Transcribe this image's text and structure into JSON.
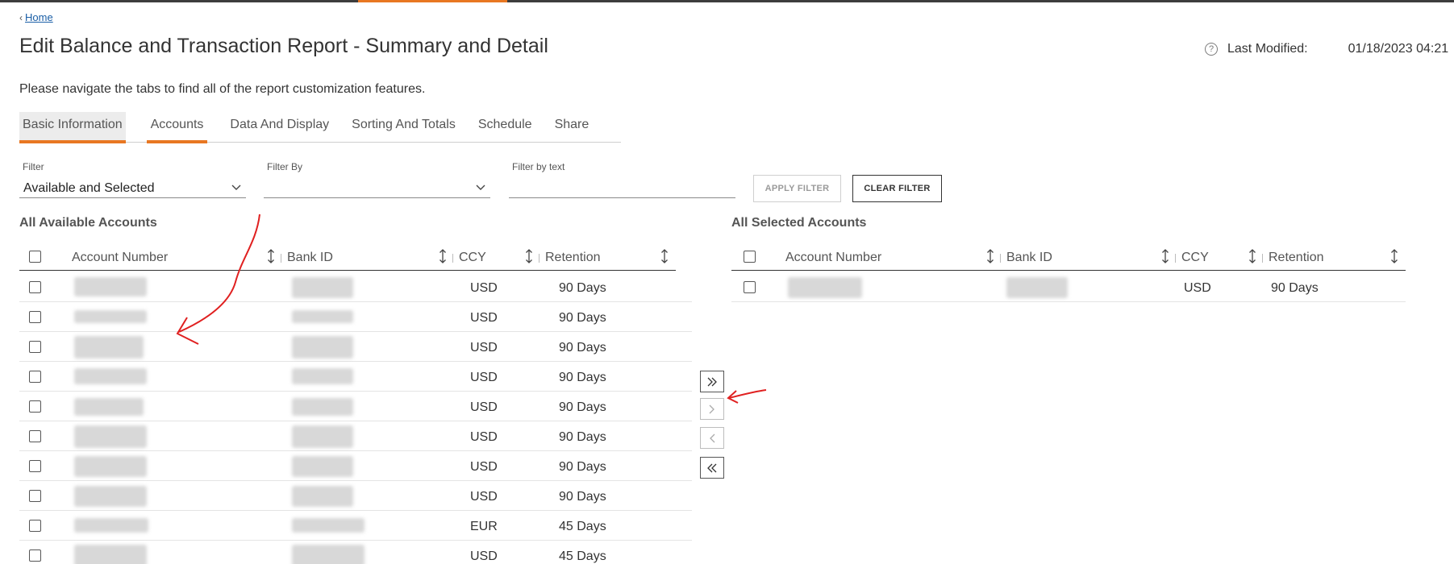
{
  "breadcrumb": {
    "home_label": "Home"
  },
  "page": {
    "title": "Edit Balance and Transaction Report - Summary and Detail",
    "last_modified_label": "Last Modified:",
    "last_modified_value": "01/18/2023 04:21",
    "intro": "Please navigate the tabs to find all of the report customization features."
  },
  "tabs": [
    {
      "label": "Basic Information"
    },
    {
      "label": "Accounts"
    },
    {
      "label": "Data And Display"
    },
    {
      "label": "Sorting And Totals"
    },
    {
      "label": "Schedule"
    },
    {
      "label": "Share"
    }
  ],
  "filters": {
    "filter_label": "Filter",
    "filter_value": "Available and Selected",
    "filter_by_label": "Filter By",
    "filter_by_value": "",
    "filter_text_label": "Filter by text",
    "filter_text_value": "",
    "apply_label": "APPLY FILTER",
    "clear_label": "CLEAR FILTER"
  },
  "available": {
    "title": "All Available Accounts",
    "columns": [
      "Account Number",
      "Bank ID",
      "CCY",
      "Retention"
    ],
    "rows": [
      {
        "ccy": "USD",
        "retention": "90 Days"
      },
      {
        "ccy": "USD",
        "retention": "90 Days"
      },
      {
        "ccy": "USD",
        "retention": "90 Days"
      },
      {
        "ccy": "USD",
        "retention": "90 Days"
      },
      {
        "ccy": "USD",
        "retention": "90 Days"
      },
      {
        "ccy": "USD",
        "retention": "90 Days"
      },
      {
        "ccy": "USD",
        "retention": "90 Days"
      },
      {
        "ccy": "USD",
        "retention": "90 Days"
      },
      {
        "ccy": "EUR",
        "retention": "45 Days"
      },
      {
        "ccy": "USD",
        "retention": "45 Days"
      }
    ]
  },
  "selected": {
    "title": "All Selected Accounts",
    "columns": [
      "Account Number",
      "Bank ID",
      "CCY",
      "Retention"
    ],
    "rows": [
      {
        "ccy": "USD",
        "retention": "90 Days"
      }
    ]
  },
  "move_buttons": [
    {
      "icon": "double-chevron-right-icon",
      "enabled": true
    },
    {
      "icon": "chevron-right-icon",
      "enabled": false
    },
    {
      "icon": "chevron-left-icon",
      "enabled": false
    },
    {
      "icon": "double-chevron-left-icon",
      "enabled": true
    }
  ],
  "colors": {
    "accent": "#e87722",
    "link": "#1a5ea6",
    "annotation": "#e02020"
  }
}
